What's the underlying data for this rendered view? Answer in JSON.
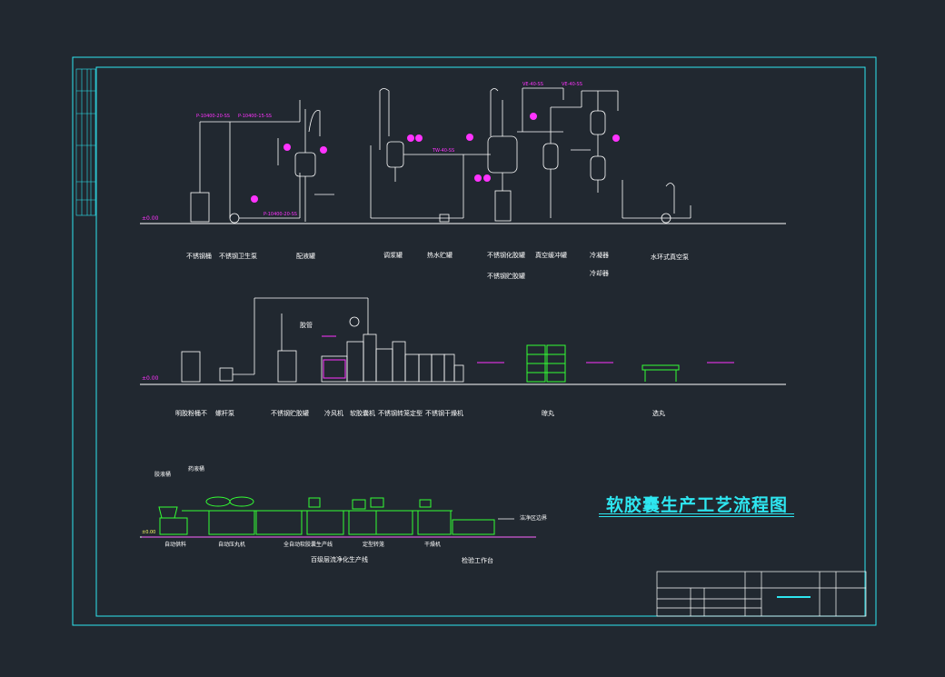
{
  "drawing": {
    "title": "软胶囊生产工艺流程图",
    "colors": {
      "background": "#212830",
      "frame": "#2ee6f0",
      "equipment": "#ffffff",
      "tags": "#ff33ff",
      "green_equipment": "#33ff33"
    }
  },
  "section1": {
    "elevation": "±0.00",
    "labels": [
      "不锈钢桶",
      "不锈钢卫生泵",
      "配液罐",
      "调浆罐",
      "热水贮罐",
      "不锈钢化胶罐",
      "不锈钢贮胶罐",
      "真空缓冲罐",
      "冷凝器",
      "冷却器",
      "水环式真空泵"
    ]
  },
  "section2": {
    "elevation": "±0.00",
    "labels": [
      "明胶粉桶不",
      "螺杆泵",
      "不锈钢贮胶罐",
      "冷风机",
      "软胶囊机",
      "不锈钢转笼定型",
      "不锈钢干燥机",
      "晾丸",
      "选丸"
    ],
    "tag": "胶管"
  },
  "section3": {
    "labels": [
      "自动供料",
      "自动压丸机",
      "全自动软胶囊生产线",
      "定型转笼",
      "干燥机",
      "百级层流净化生产线",
      "检验工作台",
      "洁净区边界"
    ],
    "callouts": [
      "胶液桶",
      "药液桶"
    ],
    "elevation": "±0.00"
  }
}
